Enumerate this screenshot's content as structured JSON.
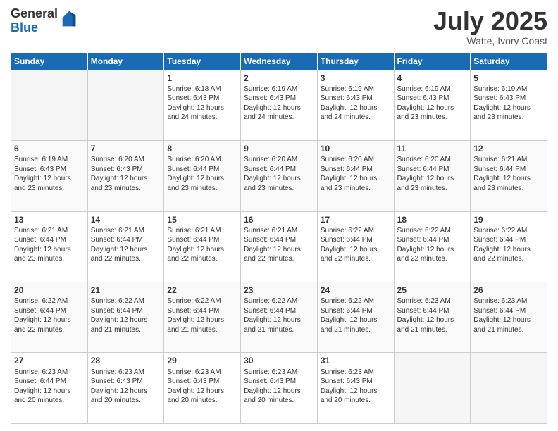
{
  "logo": {
    "general": "General",
    "blue": "Blue"
  },
  "title": "July 2025",
  "subtitle": "Watte, Ivory Coast",
  "days_of_week": [
    "Sunday",
    "Monday",
    "Tuesday",
    "Wednesday",
    "Thursday",
    "Friday",
    "Saturday"
  ],
  "weeks": [
    [
      {
        "day": "",
        "info": ""
      },
      {
        "day": "",
        "info": ""
      },
      {
        "day": "1",
        "sunrise": "Sunrise: 6:18 AM",
        "sunset": "Sunset: 6:43 PM",
        "daylight": "Daylight: 12 hours and 24 minutes."
      },
      {
        "day": "2",
        "sunrise": "Sunrise: 6:19 AM",
        "sunset": "Sunset: 6:43 PM",
        "daylight": "Daylight: 12 hours and 24 minutes."
      },
      {
        "day": "3",
        "sunrise": "Sunrise: 6:19 AM",
        "sunset": "Sunset: 6:43 PM",
        "daylight": "Daylight: 12 hours and 24 minutes."
      },
      {
        "day": "4",
        "sunrise": "Sunrise: 6:19 AM",
        "sunset": "Sunset: 6:43 PM",
        "daylight": "Daylight: 12 hours and 23 minutes."
      },
      {
        "day": "5",
        "sunrise": "Sunrise: 6:19 AM",
        "sunset": "Sunset: 6:43 PM",
        "daylight": "Daylight: 12 hours and 23 minutes."
      }
    ],
    [
      {
        "day": "6",
        "sunrise": "Sunrise: 6:19 AM",
        "sunset": "Sunset: 6:43 PM",
        "daylight": "Daylight: 12 hours and 23 minutes."
      },
      {
        "day": "7",
        "sunrise": "Sunrise: 6:20 AM",
        "sunset": "Sunset: 6:43 PM",
        "daylight": "Daylight: 12 hours and 23 minutes."
      },
      {
        "day": "8",
        "sunrise": "Sunrise: 6:20 AM",
        "sunset": "Sunset: 6:44 PM",
        "daylight": "Daylight: 12 hours and 23 minutes."
      },
      {
        "day": "9",
        "sunrise": "Sunrise: 6:20 AM",
        "sunset": "Sunset: 6:44 PM",
        "daylight": "Daylight: 12 hours and 23 minutes."
      },
      {
        "day": "10",
        "sunrise": "Sunrise: 6:20 AM",
        "sunset": "Sunset: 6:44 PM",
        "daylight": "Daylight: 12 hours and 23 minutes."
      },
      {
        "day": "11",
        "sunrise": "Sunrise: 6:20 AM",
        "sunset": "Sunset: 6:44 PM",
        "daylight": "Daylight: 12 hours and 23 minutes."
      },
      {
        "day": "12",
        "sunrise": "Sunrise: 6:21 AM",
        "sunset": "Sunset: 6:44 PM",
        "daylight": "Daylight: 12 hours and 23 minutes."
      }
    ],
    [
      {
        "day": "13",
        "sunrise": "Sunrise: 6:21 AM",
        "sunset": "Sunset: 6:44 PM",
        "daylight": "Daylight: 12 hours and 23 minutes."
      },
      {
        "day": "14",
        "sunrise": "Sunrise: 6:21 AM",
        "sunset": "Sunset: 6:44 PM",
        "daylight": "Daylight: 12 hours and 22 minutes."
      },
      {
        "day": "15",
        "sunrise": "Sunrise: 6:21 AM",
        "sunset": "Sunset: 6:44 PM",
        "daylight": "Daylight: 12 hours and 22 minutes."
      },
      {
        "day": "16",
        "sunrise": "Sunrise: 6:21 AM",
        "sunset": "Sunset: 6:44 PM",
        "daylight": "Daylight: 12 hours and 22 minutes."
      },
      {
        "day": "17",
        "sunrise": "Sunrise: 6:22 AM",
        "sunset": "Sunset: 6:44 PM",
        "daylight": "Daylight: 12 hours and 22 minutes."
      },
      {
        "day": "18",
        "sunrise": "Sunrise: 6:22 AM",
        "sunset": "Sunset: 6:44 PM",
        "daylight": "Daylight: 12 hours and 22 minutes."
      },
      {
        "day": "19",
        "sunrise": "Sunrise: 6:22 AM",
        "sunset": "Sunset: 6:44 PM",
        "daylight": "Daylight: 12 hours and 22 minutes."
      }
    ],
    [
      {
        "day": "20",
        "sunrise": "Sunrise: 6:22 AM",
        "sunset": "Sunset: 6:44 PM",
        "daylight": "Daylight: 12 hours and 22 minutes."
      },
      {
        "day": "21",
        "sunrise": "Sunrise: 6:22 AM",
        "sunset": "Sunset: 6:44 PM",
        "daylight": "Daylight: 12 hours and 21 minutes."
      },
      {
        "day": "22",
        "sunrise": "Sunrise: 6:22 AM",
        "sunset": "Sunset: 6:44 PM",
        "daylight": "Daylight: 12 hours and 21 minutes."
      },
      {
        "day": "23",
        "sunrise": "Sunrise: 6:22 AM",
        "sunset": "Sunset: 6:44 PM",
        "daylight": "Daylight: 12 hours and 21 minutes."
      },
      {
        "day": "24",
        "sunrise": "Sunrise: 6:22 AM",
        "sunset": "Sunset: 6:44 PM",
        "daylight": "Daylight: 12 hours and 21 minutes."
      },
      {
        "day": "25",
        "sunrise": "Sunrise: 6:23 AM",
        "sunset": "Sunset: 6:44 PM",
        "daylight": "Daylight: 12 hours and 21 minutes."
      },
      {
        "day": "26",
        "sunrise": "Sunrise: 6:23 AM",
        "sunset": "Sunset: 6:44 PM",
        "daylight": "Daylight: 12 hours and 21 minutes."
      }
    ],
    [
      {
        "day": "27",
        "sunrise": "Sunrise: 6:23 AM",
        "sunset": "Sunset: 6:44 PM",
        "daylight": "Daylight: 12 hours and 20 minutes."
      },
      {
        "day": "28",
        "sunrise": "Sunrise: 6:23 AM",
        "sunset": "Sunset: 6:43 PM",
        "daylight": "Daylight: 12 hours and 20 minutes."
      },
      {
        "day": "29",
        "sunrise": "Sunrise: 6:23 AM",
        "sunset": "Sunset: 6:43 PM",
        "daylight": "Daylight: 12 hours and 20 minutes."
      },
      {
        "day": "30",
        "sunrise": "Sunrise: 6:23 AM",
        "sunset": "Sunset: 6:43 PM",
        "daylight": "Daylight: 12 hours and 20 minutes."
      },
      {
        "day": "31",
        "sunrise": "Sunrise: 6:23 AM",
        "sunset": "Sunset: 6:43 PM",
        "daylight": "Daylight: 12 hours and 20 minutes."
      },
      {
        "day": "",
        "info": ""
      },
      {
        "day": "",
        "info": ""
      }
    ]
  ]
}
